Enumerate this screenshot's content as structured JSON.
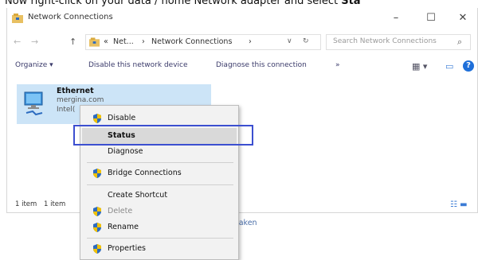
{
  "caption": {
    "prefix": "Now right-click on your data / home Network adapter and select ",
    "highlight": "Sta"
  },
  "window": {
    "title": "Network Connections",
    "controls": {
      "minimize": "–",
      "maximize": "☐",
      "close": "✕"
    }
  },
  "address": {
    "back": "←",
    "forward": "→",
    "up": "↑",
    "crumb_prefix": "«",
    "crumb1": "Net...",
    "sep": "›",
    "crumb2": "Network Connections",
    "crumb_end": "›",
    "dropdown": "∨",
    "refresh": "↻",
    "search_placeholder": "Search Network Connections",
    "search_glyph": "⌕"
  },
  "toolbar": {
    "organize": "Organize ▾",
    "disable": "Disable this network device",
    "diagnose": "Diagnose this connection",
    "more": "»",
    "view_glyph": "▦ ▾",
    "pane_glyph": "▭",
    "help_glyph": "?"
  },
  "item": {
    "name": "Ethernet",
    "sub1": "mergina.com",
    "sub2": "Intel("
  },
  "context_menu": {
    "items": [
      "Disable",
      "Status",
      "Diagnose",
      "Bridge Connections",
      "Create Shortcut",
      "Delete",
      "Rename",
      "Properties"
    ]
  },
  "statusbar": {
    "count": "1 item",
    "selected": "1 item",
    "view_glyph": "☷ ▬"
  },
  "below_link": "taken",
  "colors": {
    "selection": "#cce4f7",
    "focus_box": "#3c4fd0",
    "shield_blue": "#2d6cc0",
    "shield_yellow": "#f2c200"
  }
}
